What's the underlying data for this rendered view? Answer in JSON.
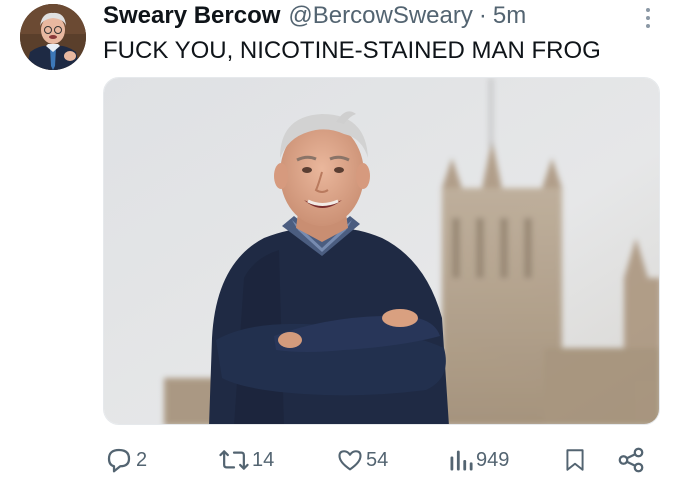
{
  "tweet": {
    "display_name": "Sweary Bercow",
    "handle": "@BercowSweary",
    "separator": "·",
    "timestamp": "5m",
    "text": "FUCK YOU, NICOTINE-STAINED MAN FROG",
    "more_icon": "more-vertical-icon",
    "media_description": "photo"
  },
  "actions": {
    "reply": {
      "icon": "reply-icon",
      "count": "2"
    },
    "retweet": {
      "icon": "retweet-icon",
      "count": "14"
    },
    "like": {
      "icon": "heart-icon",
      "count": "54"
    },
    "views": {
      "icon": "views-chart-icon",
      "count": "949"
    },
    "bookmark": {
      "icon": "bookmark-icon"
    },
    "share": {
      "icon": "share-icon"
    }
  },
  "colors": {
    "text_primary": "#0f1419",
    "text_secondary": "#536471",
    "sweater": "#1f2a44"
  }
}
